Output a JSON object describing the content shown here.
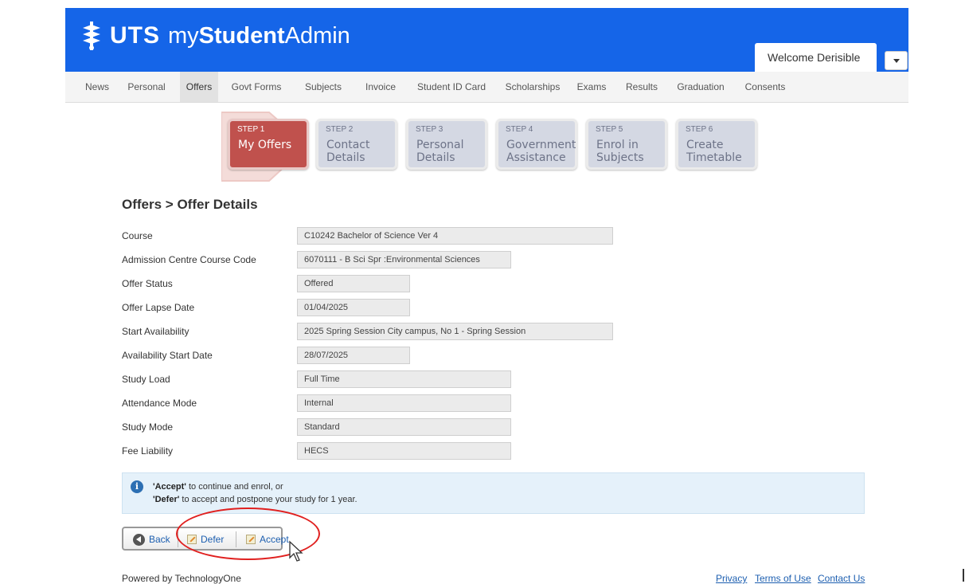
{
  "header": {
    "logo": {
      "uts": "UTS",
      "my": "my",
      "student": "Student",
      "admin": "Admin"
    },
    "welcome": "Welcome Derisible",
    "brand_color": "#1565e8"
  },
  "nav": [
    "News",
    "Personal",
    "Offers",
    "Govt Forms",
    "Subjects",
    "Invoice",
    "Student ID Card",
    "Scholarships",
    "Exams",
    "Results",
    "Graduation",
    "Consents"
  ],
  "nav_active": "Offers",
  "steps": [
    {
      "num": "STEP 1",
      "title": "My Offers"
    },
    {
      "num": "STEP 2",
      "title": "Contact\nDetails"
    },
    {
      "num": "STEP 3",
      "title": "Personal\nDetails"
    },
    {
      "num": "STEP 4",
      "title": "Government\nAssistance"
    },
    {
      "num": "STEP 5",
      "title": "Enrol in\nSubjects"
    },
    {
      "num": "STEP 6",
      "title": "Create\nTimetable"
    }
  ],
  "page_title": "Offers > Offer Details",
  "fields": [
    {
      "label": "Course",
      "value": "C10242 Bachelor of Science Ver 4"
    },
    {
      "label": "Admission Centre Course Code",
      "value": "6070111 - B Sci Spr :Environmental Sciences"
    },
    {
      "label": "Offer Status",
      "value": "Offered"
    },
    {
      "label": "Offer Lapse Date",
      "value": "01/04/2025"
    },
    {
      "label": "Start Availability",
      "value": "2025 Spring Session City campus, No 1 - Spring Session"
    },
    {
      "label": "Availability Start Date",
      "value": "28/07/2025"
    },
    {
      "label": "Study Load",
      "value": "Full Time"
    },
    {
      "label": "Attendance Mode",
      "value": "Internal"
    },
    {
      "label": "Study Mode",
      "value": "Standard"
    },
    {
      "label": "Fee Liability",
      "value": "HECS"
    }
  ],
  "info": {
    "accept_word": "'Accept'",
    "accept_text": " to continue and enrol, or",
    "defer_word": "'Defer'",
    "defer_text": " to accept and postpone your study for 1 year."
  },
  "buttons": {
    "back": "Back",
    "defer": "Defer",
    "accept": "Accept"
  },
  "footer": {
    "powered": "Powered by TechnologyOne",
    "privacy": "Privacy",
    "terms": "Terms of Use",
    "contact": "Contact Us"
  }
}
